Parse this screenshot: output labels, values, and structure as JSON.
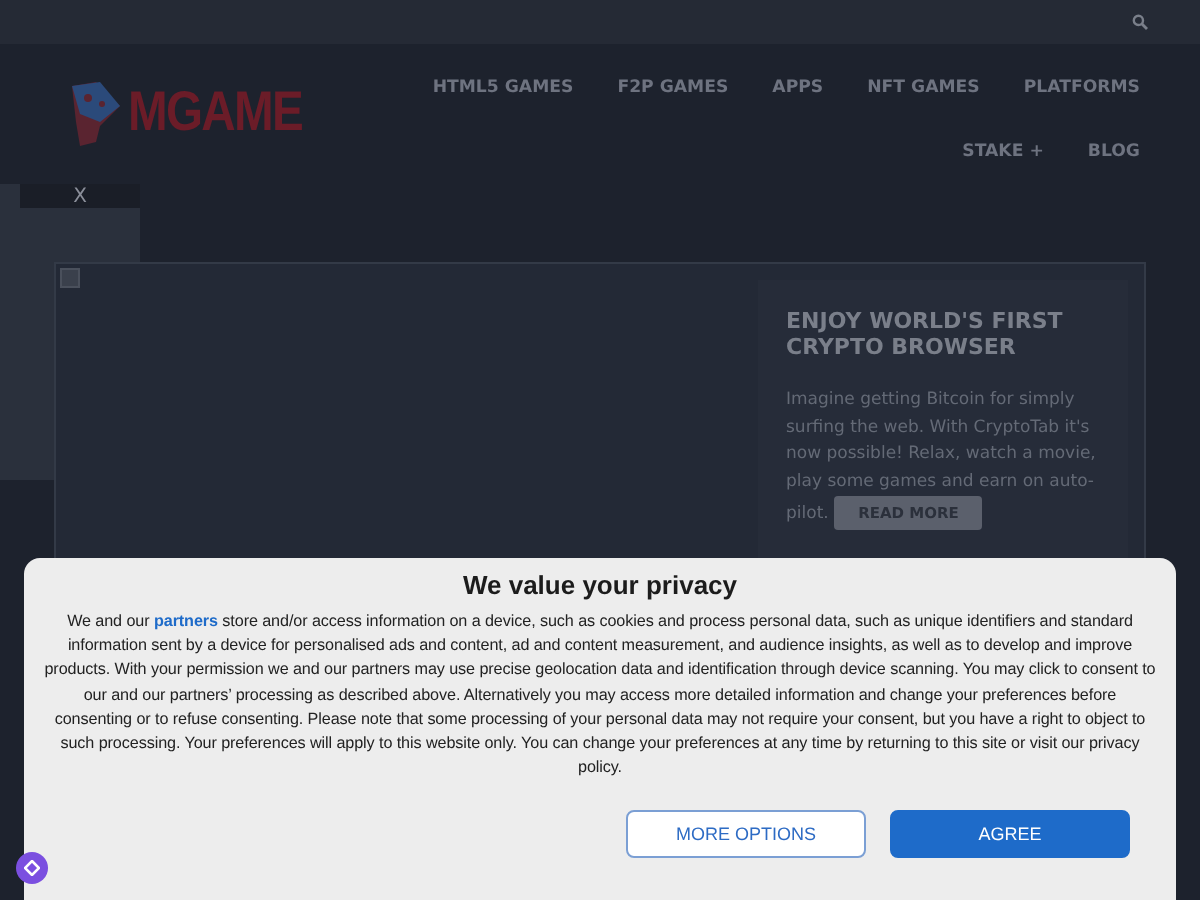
{
  "header": {
    "logo": "MGAME",
    "nav": [
      {
        "label": "HTML5 GAMES"
      },
      {
        "label": "F2P GAMES"
      },
      {
        "label": "APPS"
      },
      {
        "label": "NFT GAMES"
      },
      {
        "label": "PLATFORMS"
      },
      {
        "label": "STAKE +"
      },
      {
        "label": "BLOG"
      }
    ]
  },
  "close_tab": "X",
  "hero": {
    "title": "ENJOY WORLD'S FIRST CRYPTO BROWSER",
    "body": "Imagine getting Bitcoin for simply surfing the web. With CryptoTab it's now possible! Relax, watch a movie, play some games and earn on auto-pilot.",
    "button": "READ MORE"
  },
  "consent": {
    "title": "We value your privacy",
    "body_start": "We and our",
    "link": "partners",
    "body": "store and/or access information on a device, such as cookies and process personal data, such as unique identifiers and standard information sent by a device for personalised ads and content, ad and content measurement, and audience insights, as well as to develop and improve products. With your permission we and our partners may use precise geolocation data and identification through device scanning. You may click to consent to our and our partners’ processing as described above. Alternatively you may access more detailed information and change your preferences before consenting or to refuse consenting. Please note that some processing of your personal data may not require your consent, but you have a right to object to such processing. Your preferences will apply to this website only. You can change your preferences at any time by returning to this site or visit our privacy policy.",
    "buttons": [
      {
        "label": "MORE OPTIONS",
        "kind": "secondary"
      },
      {
        "label": "AGREE",
        "kind": "primary"
      }
    ]
  }
}
